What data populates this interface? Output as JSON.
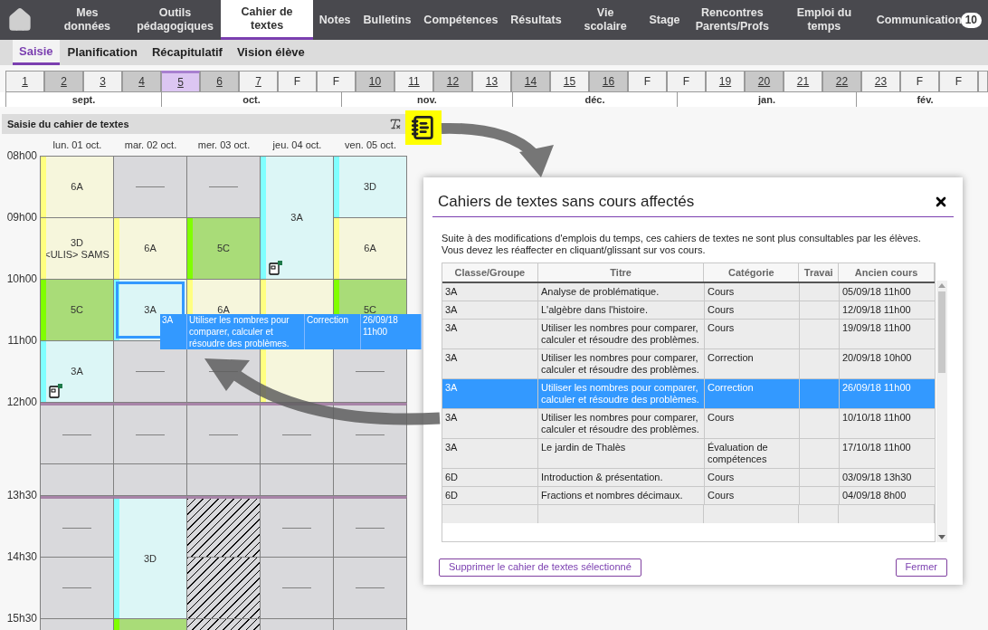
{
  "nav": {
    "items": [
      {
        "label": "Mes données",
        "selected": false
      },
      {
        "label": "Outils pédagogiques",
        "selected": false
      },
      {
        "label": "Cahier de textes",
        "selected": true
      },
      {
        "label": "Notes",
        "selected": false
      },
      {
        "label": "Bulletins",
        "selected": false
      },
      {
        "label": "Compétences",
        "selected": false
      },
      {
        "label": "Résultats",
        "selected": false
      },
      {
        "label": "Vie scolaire",
        "selected": false
      },
      {
        "label": "Stage",
        "selected": false
      },
      {
        "label": "Rencontres Parents/Profs",
        "selected": false
      },
      {
        "label": "Emploi du temps",
        "selected": false
      },
      {
        "label": "Communication",
        "selected": false,
        "badge": "10"
      }
    ]
  },
  "subnav": [
    {
      "label": "Saisie",
      "selected": true
    },
    {
      "label": "Planification",
      "selected": false
    },
    {
      "label": "Récapitulatif",
      "selected": false
    },
    {
      "label": "Vision élève",
      "selected": false
    }
  ],
  "weeks": [
    {
      "label": "1",
      "kind": "week",
      "shaded": false,
      "selected": false
    },
    {
      "label": "2",
      "kind": "week",
      "shaded": true,
      "selected": false
    },
    {
      "label": "3",
      "kind": "week",
      "shaded": false,
      "selected": false
    },
    {
      "label": "4",
      "kind": "week",
      "shaded": true,
      "selected": false
    },
    {
      "label": "5",
      "kind": "week",
      "shaded": false,
      "selected": true
    },
    {
      "label": "6",
      "kind": "week",
      "shaded": true,
      "selected": false
    },
    {
      "label": "7",
      "kind": "week",
      "shaded": false,
      "selected": false
    },
    {
      "label": "F",
      "kind": "holiday",
      "shaded": false,
      "selected": false
    },
    {
      "label": "F",
      "kind": "holiday",
      "shaded": false,
      "selected": false
    },
    {
      "label": "10",
      "kind": "week",
      "shaded": true,
      "selected": false
    },
    {
      "label": "11",
      "kind": "week",
      "shaded": false,
      "selected": false
    },
    {
      "label": "12",
      "kind": "week",
      "shaded": true,
      "selected": false
    },
    {
      "label": "13",
      "kind": "week",
      "shaded": false,
      "selected": false
    },
    {
      "label": "14",
      "kind": "week",
      "shaded": true,
      "selected": false
    },
    {
      "label": "15",
      "kind": "week",
      "shaded": false,
      "selected": false
    },
    {
      "label": "16",
      "kind": "week",
      "shaded": true,
      "selected": false
    },
    {
      "label": "F",
      "kind": "holiday",
      "shaded": false,
      "selected": false
    },
    {
      "label": "F",
      "kind": "holiday",
      "shaded": false,
      "selected": false
    },
    {
      "label": "19",
      "kind": "week",
      "shaded": false,
      "selected": false
    },
    {
      "label": "20",
      "kind": "week",
      "shaded": true,
      "selected": false
    },
    {
      "label": "21",
      "kind": "week",
      "shaded": false,
      "selected": false
    },
    {
      "label": "22",
      "kind": "week",
      "shaded": true,
      "selected": false
    },
    {
      "label": "23",
      "kind": "week",
      "shaded": false,
      "selected": false
    },
    {
      "label": "F",
      "kind": "holiday",
      "shaded": false,
      "selected": false
    },
    {
      "label": "F",
      "kind": "holiday",
      "shaded": false,
      "selected": false
    }
  ],
  "months": [
    "sept.",
    "oct.",
    "nov.",
    "déc.",
    "jan.",
    "fév."
  ],
  "panel": {
    "title": "Saisie du cahier de textes"
  },
  "days": [
    "lun. 01 oct.",
    "mar. 02 oct.",
    "mer. 03 oct.",
    "jeu. 04 oct.",
    "ven. 05 oct."
  ],
  "times": [
    "08h00",
    "09h00",
    "10h00",
    "11h00",
    "12h00",
    "13h30",
    "14h30",
    "15h30"
  ],
  "schedule": [
    {
      "slots": [
        {
          "kind": "course",
          "lines": [
            "6A"
          ],
          "color": "#ffff80"
        },
        {
          "kind": "course",
          "lines": [
            "3D",
            "<ULIS> SAMS"
          ],
          "color": "#ffff80"
        },
        {
          "kind": "course",
          "lines": [
            "5C"
          ],
          "color": "#80ff00"
        },
        {
          "kind": "course",
          "lines": [
            "3A"
          ],
          "color": "#80ffff",
          "note": true
        },
        {
          "kind": "free"
        },
        {
          "kind": "blank"
        },
        {
          "kind": "free"
        },
        {
          "kind": "free"
        },
        {
          "kind": "free"
        }
      ]
    },
    {
      "slots": [
        {
          "kind": "free"
        },
        {
          "kind": "course",
          "lines": [
            "6A"
          ],
          "color": "#ffff80"
        },
        {
          "kind": "course",
          "lines": [
            "3A"
          ],
          "color": "#80ffff",
          "selected": true
        },
        {
          "kind": "free"
        },
        {
          "kind": "free"
        },
        {
          "kind": "blank"
        },
        {
          "kind": "course",
          "lines": [
            "3D"
          ],
          "color": "#80ffff",
          "tall": true
        },
        {
          "kind": "course",
          "color": "#80ff00"
        }
      ]
    },
    {
      "slots": [
        {
          "kind": "free"
        },
        {
          "kind": "course",
          "lines": [
            "5C"
          ],
          "color": "#80ff00"
        },
        {
          "kind": "course",
          "lines": [
            "6A"
          ],
          "color": "#ffff80"
        },
        {
          "kind": "free"
        },
        {
          "kind": "free"
        },
        {
          "kind": "blank"
        },
        {
          "kind": "hatched"
        },
        {
          "kind": "hatched"
        },
        {
          "kind": "hatched"
        }
      ]
    },
    {
      "slots": [
        {
          "kind": "course",
          "lines": [
            "3A"
          ],
          "color": "#80ffff",
          "tall": true,
          "note": true
        },
        {
          "kind": "course",
          "color": "#ffff80",
          "tall": true
        },
        {
          "kind": "free"
        },
        {
          "kind": "blank"
        },
        {
          "kind": "free"
        },
        {
          "kind": "free"
        },
        {
          "kind": "free"
        }
      ]
    },
    {
      "slots": [
        {
          "kind": "course",
          "lines": [
            "3D"
          ],
          "color": "#80ffff"
        },
        {
          "kind": "course",
          "lines": [
            "6A"
          ],
          "color": "#ffff80"
        },
        {
          "kind": "course",
          "lines": [
            "5C"
          ],
          "color": "#80ff00"
        },
        {
          "kind": "free"
        },
        {
          "kind": "free"
        },
        {
          "kind": "blank"
        },
        {
          "kind": "free"
        },
        {
          "kind": "free"
        },
        {
          "kind": "free"
        }
      ]
    }
  ],
  "drag_ghost": {
    "cells": [
      "3A",
      "Utiliser les nombres pour comparer, calculer et résoudre des problèmes.",
      "Correction",
      "26/09/18 11h00"
    ]
  },
  "dialog": {
    "title": "Cahiers de textes sans cours affectés",
    "message": "Suite à des modifications d'emplois du temps, ces cahiers de textes ne sont plus consultables par les élèves. Vous devez les réaffecter en cliquant/glissant sur vos cours.",
    "columns": [
      "Classe/Groupe",
      "Titre",
      "Catégorie",
      "Travai",
      "Ancien cours"
    ],
    "rows": [
      {
        "cells": [
          "3A",
          "Analyse de problématique.",
          "Cours",
          "",
          "05/09/18 11h00"
        ],
        "selected": false
      },
      {
        "cells": [
          "3A",
          "L'algèbre dans l'histoire.",
          "Cours",
          "",
          "12/09/18 11h00"
        ],
        "selected": false
      },
      {
        "cells": [
          "3A",
          "Utiliser les nombres pour comparer, calculer et résoudre des problèmes.",
          "Cours",
          "",
          "19/09/18 11h00"
        ],
        "selected": false
      },
      {
        "cells": [
          "3A",
          "Utiliser les nombres pour comparer, calculer et résoudre des problèmes.",
          "Correction",
          "",
          "20/09/18 10h00"
        ],
        "selected": false
      },
      {
        "cells": [
          "3A",
          "Utiliser les nombres pour comparer, calculer et résoudre des problèmes.",
          "Correction",
          "",
          "26/09/18 11h00"
        ],
        "selected": true
      },
      {
        "cells": [
          "3A",
          "Utiliser les nombres pour comparer, calculer et résoudre des problèmes.",
          "Cours",
          "",
          "10/10/18 11h00"
        ],
        "selected": false
      },
      {
        "cells": [
          "3A",
          "Le jardin de Thalès",
          "Évaluation de compétences",
          "",
          "17/10/18 11h00"
        ],
        "selected": false
      },
      {
        "cells": [
          "6D",
          "Introduction & présentation.",
          "Cours",
          "",
          "03/09/18 13h30"
        ],
        "selected": false
      },
      {
        "cells": [
          "6D",
          "Fractions et nombres décimaux.",
          "Cours",
          "",
          "04/09/18 8h00"
        ],
        "selected": false
      }
    ],
    "buttons": [
      "Supprimer le cahier de textes sélectionné",
      "Fermer"
    ]
  }
}
